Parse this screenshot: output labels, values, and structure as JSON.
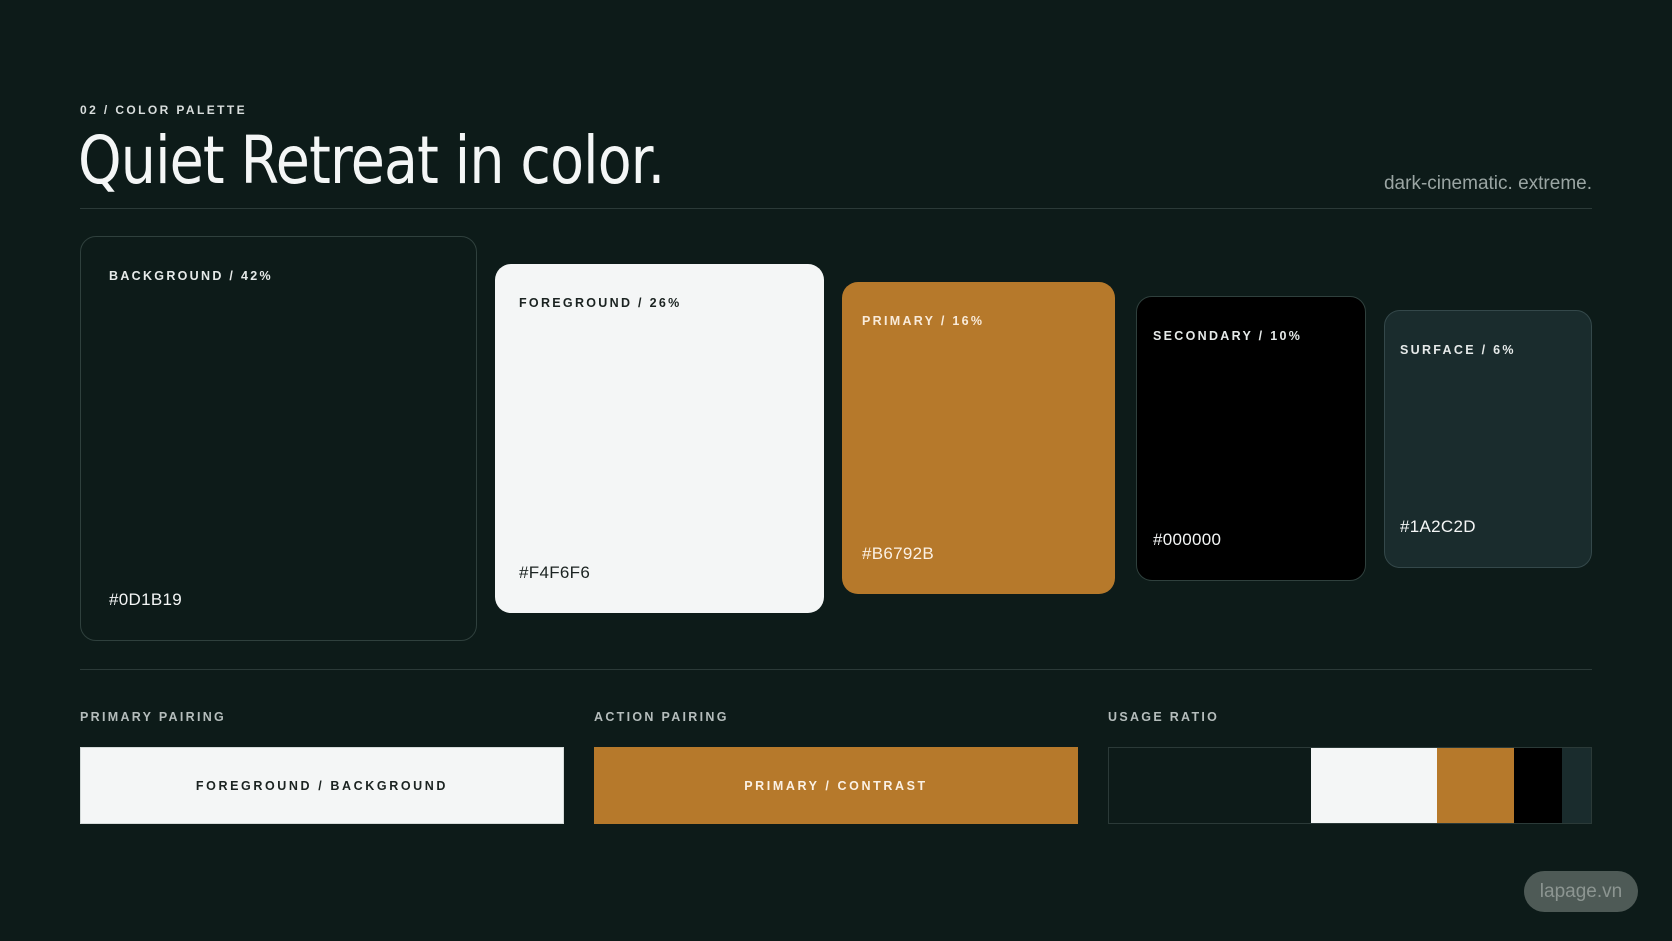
{
  "header": {
    "eyebrow": "02 / COLOR PALETTE",
    "title": "Quiet Retreat in color.",
    "subtitle": "dark-cinematic. extreme."
  },
  "swatches": [
    {
      "label": "BACKGROUND / 42%",
      "hex": "#0D1B19",
      "share": 42
    },
    {
      "label": "FOREGROUND / 26%",
      "hex": "#F4F6F6",
      "share": 26
    },
    {
      "label": "PRIMARY / 16%",
      "hex": "#B6792B",
      "share": 16
    },
    {
      "label": "SECONDARY / 10%",
      "hex": "#000000",
      "share": 10
    },
    {
      "label": "SURFACE / 6%",
      "hex": "#1A2C2D",
      "share": 6
    }
  ],
  "pairings": {
    "primary_label": "PRIMARY PAIRING",
    "primary_text": "FOREGROUND / BACKGROUND",
    "action_label": "ACTION PAIRING",
    "action_text": "PRIMARY / CONTRAST",
    "usage_label": "USAGE RATIO"
  },
  "watermark": "lapage.vn"
}
